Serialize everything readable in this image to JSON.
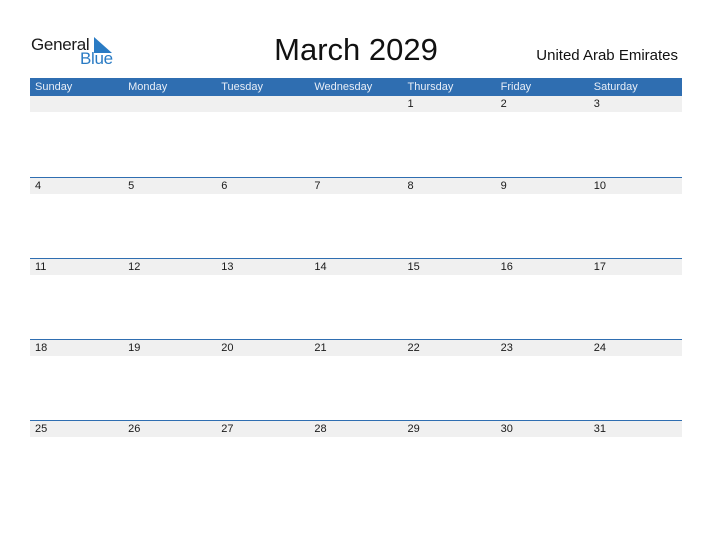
{
  "logo": {
    "word1": "General",
    "word2": "Blue"
  },
  "title": "March 2029",
  "country": "United Arab Emirates",
  "weekdays": [
    "Sunday",
    "Monday",
    "Tuesday",
    "Wednesday",
    "Thursday",
    "Friday",
    "Saturday"
  ],
  "weeks": [
    [
      "",
      "",
      "",
      "",
      "1",
      "2",
      "3"
    ],
    [
      "4",
      "5",
      "6",
      "7",
      "8",
      "9",
      "10"
    ],
    [
      "11",
      "12",
      "13",
      "14",
      "15",
      "16",
      "17"
    ],
    [
      "18",
      "19",
      "20",
      "21",
      "22",
      "23",
      "24"
    ],
    [
      "25",
      "26",
      "27",
      "28",
      "29",
      "30",
      "31"
    ]
  ],
  "colors": {
    "accent": "#2f6eb1",
    "logo_blue": "#2a7bc4",
    "date_strip": "#f0f0f0"
  }
}
